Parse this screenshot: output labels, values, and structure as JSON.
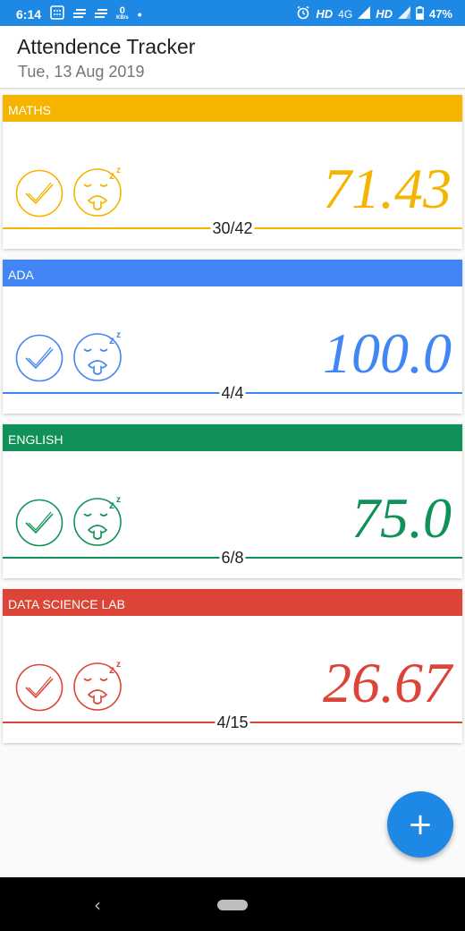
{
  "status_bar": {
    "time": "6:14",
    "speed_value": "0",
    "speed_unit": "KB/s",
    "network_1": "HD",
    "network_type": "4G",
    "network_2": "HD",
    "battery": "47%"
  },
  "app_bar": {
    "title": "Attendence Tracker",
    "date": "Tue, 13 Aug 2019"
  },
  "subjects": [
    {
      "name": "MATHS",
      "percent": "71.43",
      "ratio": "30/42",
      "color": "#f4b400"
    },
    {
      "name": "ADA",
      "percent": "100.0",
      "ratio": "4/4",
      "color": "#4285f4"
    },
    {
      "name": "ENGLISH",
      "percent": "75.0",
      "ratio": "6/8",
      "color": "#0f9158"
    },
    {
      "name": "DATA SCIENCE LAB",
      "percent": "26.67",
      "ratio": "4/15",
      "color": "#db4437"
    }
  ],
  "fab": {
    "label": "+"
  },
  "icons": {
    "present": "check-circle-icon",
    "bunk": "sleeping-face-icon",
    "fab": "add-icon",
    "back": "back-icon",
    "home": "home-pill-icon"
  }
}
